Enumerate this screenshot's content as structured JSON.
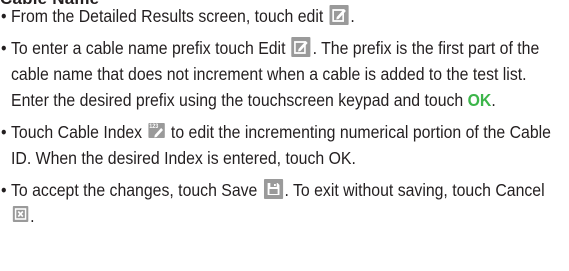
{
  "section_title": "Cable Name",
  "items": [
    {
      "parts": [
        "From the Detailed Results screen, touch edit ",
        "."
      ]
    },
    {
      "parts": [
        "To enter a cable name prefix touch Edit ",
        ". The prefix is the first part of the cable name that does not increment when a cable is added to the test list. Enter the desired prefix using the touchscreen keypad and touch ",
        "OK",
        "."
      ]
    },
    {
      "parts": [
        "Touch Cable Index ",
        " to edit the incrementing numerical portion of the Cable ID. When the desired Index is entered, touch OK."
      ],
      "index_icon_text": "123"
    },
    {
      "parts": [
        "To accept the changes, touch Save ",
        ". To exit without saving, touch Cancel ",
        "."
      ]
    }
  ],
  "icons": {
    "edit": "edit-icon",
    "index": "cable-index-icon",
    "save": "save-icon",
    "cancel": "cancel-icon"
  },
  "colors": {
    "text": "#231f20",
    "icon_bg": "#9a9a9a",
    "ok": "#3cb54a"
  }
}
